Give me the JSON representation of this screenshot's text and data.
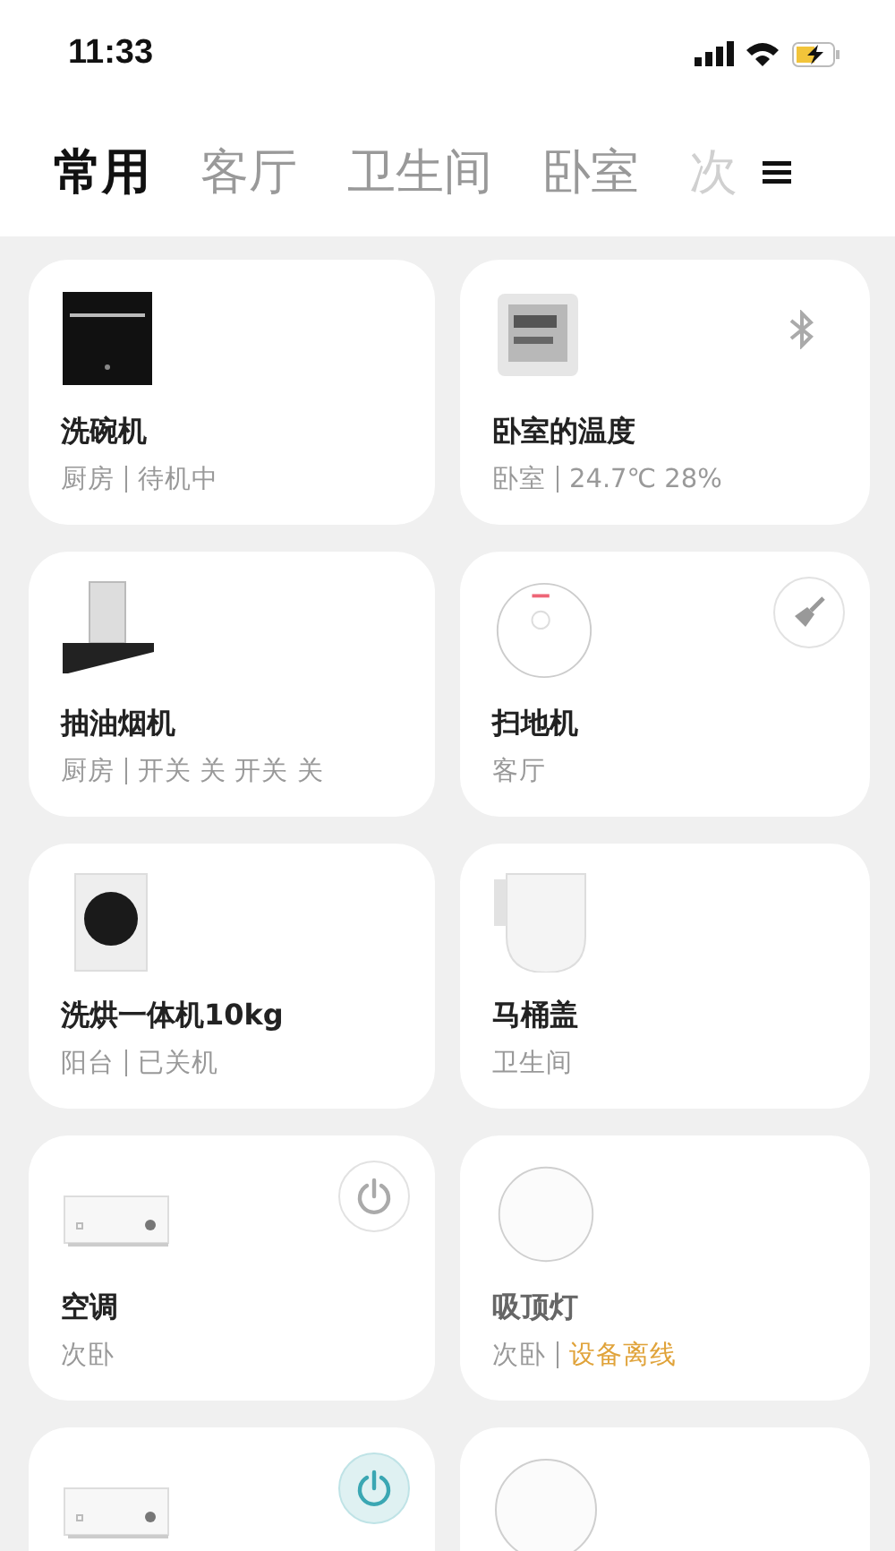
{
  "status_bar": {
    "time": "11:33"
  },
  "tabs": [
    {
      "label": "常用",
      "selected": true
    },
    {
      "label": "客厅",
      "selected": false
    },
    {
      "label": "卫生间",
      "selected": false
    },
    {
      "label": "卧室",
      "selected": false
    },
    {
      "label": "次",
      "selected": false,
      "faded": true
    }
  ],
  "devices": [
    {
      "kind": "dishwasher",
      "name": "洗碗机",
      "room": "厨房",
      "status": "待机中",
      "offline": false
    },
    {
      "kind": "thermometer",
      "name": "卧室的温度",
      "room": "卧室",
      "status": "24.7℃ 28%",
      "offline": false,
      "control": {
        "kind": "bluetooth"
      }
    },
    {
      "kind": "range_hood",
      "name": "抽油烟机",
      "room": "厨房",
      "status": "开关 关 开关 关",
      "offline": false
    },
    {
      "kind": "robot_vacuum",
      "name": "扫地机",
      "room": "客厅",
      "offline": false,
      "control": {
        "kind": "sweep"
      }
    },
    {
      "kind": "washer",
      "name": "洗烘一体机10kg",
      "room": "阳台",
      "status": "已关机",
      "offline": false
    },
    {
      "kind": "toilet_seat",
      "name": "马桶盖",
      "room": "卫生间",
      "offline": false
    },
    {
      "kind": "air_conditioner",
      "name": "空调",
      "room": "次卧",
      "offline": false,
      "control": {
        "kind": "power",
        "on": false
      }
    },
    {
      "kind": "ceiling_light",
      "name": "吸顶灯",
      "room": "次卧",
      "status": "设备离线",
      "offline": true
    },
    {
      "kind": "air_conditioner",
      "control": {
        "kind": "power",
        "on": true
      }
    },
    {
      "kind": "ceiling_light"
    }
  ]
}
